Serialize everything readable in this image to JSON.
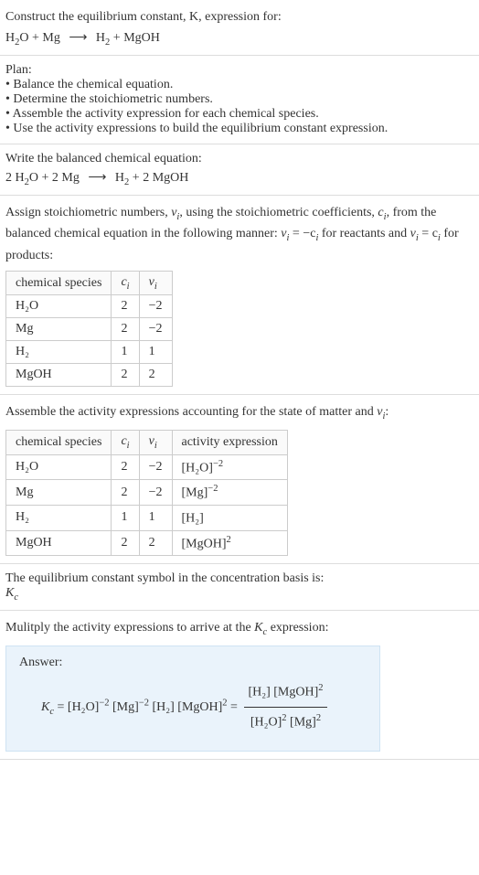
{
  "intro": {
    "line1": "Construct the equilibrium constant, K, expression for:",
    "eq_lhs1": "H",
    "eq_lhs1_sub": "2",
    "eq_lhs1b": "O + Mg",
    "eq_rhs1": "H",
    "eq_rhs1_sub": "2",
    "eq_rhs1b": " + MgOH"
  },
  "plan": {
    "heading": "Plan:",
    "b1": "• Balance the chemical equation.",
    "b2": "• Determine the stoichiometric numbers.",
    "b3": "• Assemble the activity expression for each chemical species.",
    "b4": "• Use the activity expressions to build the equilibrium constant expression."
  },
  "balanced": {
    "heading": "Write the balanced chemical equation:",
    "lhs": "2 H",
    "lhs_sub": "2",
    "lhs_b": "O + 2 Mg",
    "rhs": "H",
    "rhs_sub": "2",
    "rhs_b": " + 2 MgOH"
  },
  "stoich": {
    "heading_a": "Assign stoichiometric numbers, ",
    "heading_b": ", using the stoichiometric coefficients, ",
    "heading_c": ", from the balanced chemical equation in the following manner: ",
    "heading_d": " for reactants and ",
    "heading_e": " for products:",
    "nu": "ν",
    "nu_sub": "i",
    "c": "c",
    "c_sub": "i",
    "rel1a": "ν",
    "rel1b": " = −c",
    "rel2a": "ν",
    "rel2b": " = c",
    "th1": "chemical species",
    "rows": [
      {
        "sp": "H₂O",
        "c": "2",
        "v": "−2"
      },
      {
        "sp": "Mg",
        "c": "2",
        "v": "−2"
      },
      {
        "sp": "H₂",
        "c": "1",
        "v": "1"
      },
      {
        "sp": "MgOH",
        "c": "2",
        "v": "2"
      }
    ]
  },
  "activity": {
    "heading_a": "Assemble the activity expressions accounting for the state of matter and ",
    "heading_b": ":",
    "th1": "chemical species",
    "th4": "activity expression",
    "rows": [
      {
        "sp": "H₂O",
        "c": "2",
        "v": "−2",
        "expr_base": "[H₂O]",
        "expr_sup": "−2"
      },
      {
        "sp": "Mg",
        "c": "2",
        "v": "−2",
        "expr_base": "[Mg]",
        "expr_sup": "−2"
      },
      {
        "sp": "H₂",
        "c": "1",
        "v": "1",
        "expr_base": "[H₂]",
        "expr_sup": ""
      },
      {
        "sp": "MgOH",
        "c": "2",
        "v": "2",
        "expr_base": "[MgOH]",
        "expr_sup": "2"
      }
    ]
  },
  "kc_symbol": {
    "heading": "The equilibrium constant symbol in the concentration basis is:",
    "K": "K",
    "sub": "c"
  },
  "multiply": {
    "heading_a": "Mulitply the activity expressions to arrive at the ",
    "heading_b": " expression:"
  },
  "answer": {
    "label": "Answer:",
    "K": "K",
    "Ksub": "c",
    "eq": " = [H₂O]",
    "p1": "−2",
    "t2": " [Mg]",
    "p2": "−2",
    "t3": " [H₂] [MgOH]",
    "p3": "2",
    "eq2": " = ",
    "num_a": "[H₂] [MgOH]",
    "num_sup": "2",
    "den_a": "[H₂O]",
    "den_sup1": "2",
    "den_b": " [Mg]",
    "den_sup2": "2"
  }
}
